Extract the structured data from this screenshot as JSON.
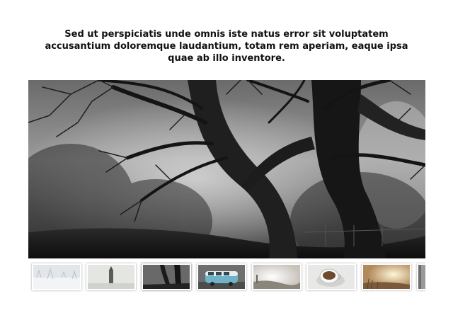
{
  "gallery": {
    "caption": "Sed ut perspiciatis unde omnis iste natus error sit voluptatem accusantium doloremque laudantium, totam rem aperiam, eaque ipsa quae ab illo inventore.",
    "active_index": 2,
    "thumbnails": [
      {
        "subject": "frosty-field"
      },
      {
        "subject": "misty-tower"
      },
      {
        "subject": "dark-forest-trees"
      },
      {
        "subject": "blue-camper-van"
      },
      {
        "subject": "hazy-sunlit-landscape"
      },
      {
        "subject": "coffee-cup"
      },
      {
        "subject": "sunlit-meadow"
      },
      {
        "subject": "partial-image"
      }
    ]
  }
}
